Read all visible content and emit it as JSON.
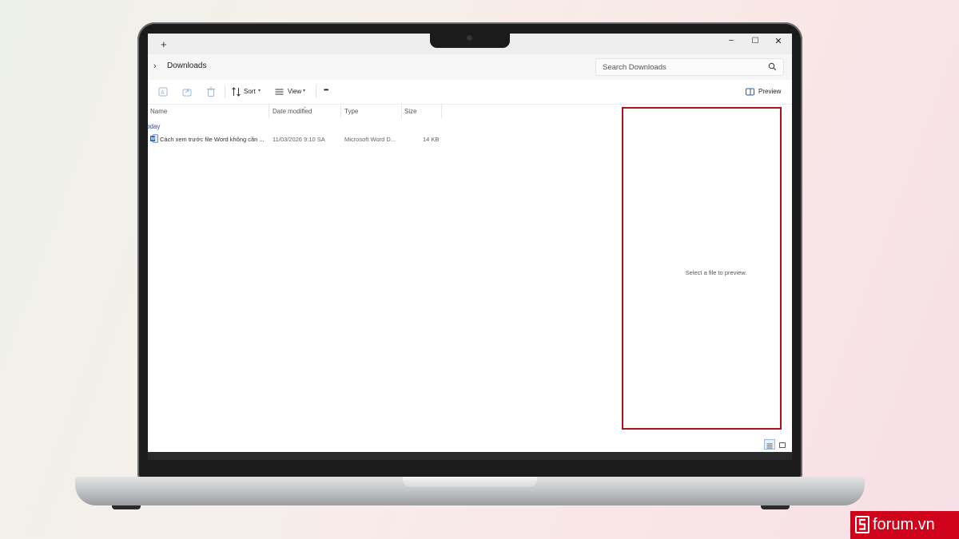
{
  "titlebar": {
    "new_tab": "+",
    "minimize": "−",
    "maximize": "☐",
    "close": "✕"
  },
  "address": {
    "chevron": "›",
    "location": "Downloads",
    "search_placeholder": "Search Downloads"
  },
  "commandbar": {
    "sort_label": "Sort",
    "view_label": "View",
    "more_label": "•••",
    "preview_label": "Preview"
  },
  "columns": {
    "name": "Name",
    "date_modified": "Date modified",
    "type": "Type",
    "size": "Size"
  },
  "group_label": "oday",
  "files": [
    {
      "name": "Cách xem trước file Word không cần ...",
      "date_modified": "11/03/2026 9:10 SA",
      "type": "Microsoft Word D...",
      "size": "14 KB",
      "icon": "word-doc-icon"
    }
  ],
  "preview": {
    "message": "Select a file to preview.",
    "highlight_color": "#b0111a"
  },
  "watermark": {
    "text": "forum.vn",
    "color": "#d0021b"
  }
}
